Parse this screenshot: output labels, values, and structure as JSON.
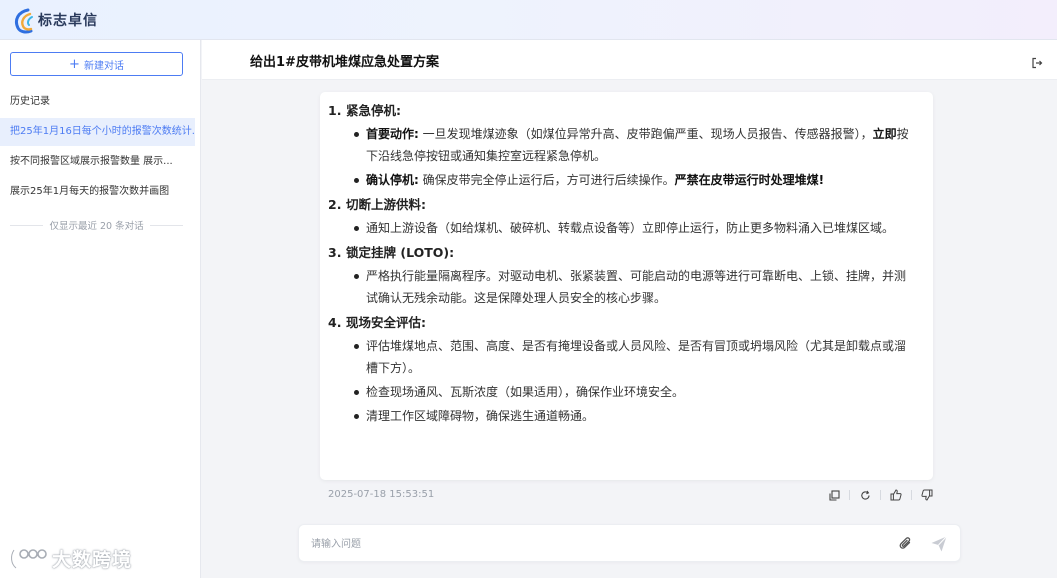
{
  "app": {
    "name": "标志卓信"
  },
  "sidebar": {
    "new_chat_label": "新建对话",
    "history_title": "历史记录",
    "items": [
      {
        "label": "把25年1月16日每个小时的报警次数统计..."
      },
      {
        "label": "按不同报警区域展示报警数量 展示..."
      },
      {
        "label": "展示25年1月每天的报警次数并画图"
      }
    ],
    "note": "仅显示最近 20 条对话"
  },
  "watermark": {
    "text": "大数跨境"
  },
  "conversation": {
    "title": "给出1#皮带机堆煤应急处置方案",
    "sections": [
      {
        "num": "1.",
        "heading": "紧急停机:",
        "bullets": [
          {
            "bold": "首要动作:",
            "text": " 一旦发现堆煤迹象（如煤位异常升高、皮带跑偏严重、现场人员报告、传感器报警），",
            "bold2": "立即",
            "text2": "按下沿线急停按钮或通知集控室远程紧急停机。"
          },
          {
            "bold": "确认停机:",
            "text": " 确保皮带完全停止运行后，方可进行后续操作。",
            "bold2": "严禁在皮带运行时处理堆煤!"
          }
        ]
      },
      {
        "num": "2.",
        "heading": "切断上游供料:",
        "bullets": [
          {
            "text": "通知上游设备（如给煤机、破碎机、转载点设备等）立即停止运行，防止更多物料涌入已堆煤区域。"
          }
        ]
      },
      {
        "num": "3.",
        "heading": "锁定挂牌 (LOTO):",
        "bullets": [
          {
            "text": "严格执行能量隔离程序。对驱动电机、张紧装置、可能启动的电源等进行可靠断电、上锁、挂牌，并测试确认无残余动能。这是保障处理人员安全的核心步骤。"
          }
        ]
      },
      {
        "num": "4.",
        "heading": "现场安全评估:",
        "bullets": [
          {
            "text": "评估堆煤地点、范围、高度、是否有掩埋设备或人员风险、是否有冒顶或坍塌风险（尤其是卸载点或溜槽下方）。"
          },
          {
            "text": "检查现场通风、瓦斯浓度（如果适用），确保作业环境安全。"
          },
          {
            "text": "清理工作区域障碍物，确保逃生通道畅通。"
          }
        ]
      }
    ],
    "timestamp": "2025-07-18 15:53:51",
    "actions": [
      "copy-icon",
      "refresh-icon",
      "thumbs-up-icon",
      "thumbs-down-icon"
    ]
  },
  "input": {
    "placeholder": "请输入问题",
    "value": ""
  },
  "colors": {
    "accent": "#4d7cf3",
    "active_bg": "#e8effd",
    "page_bg": "#f3f4f7"
  }
}
